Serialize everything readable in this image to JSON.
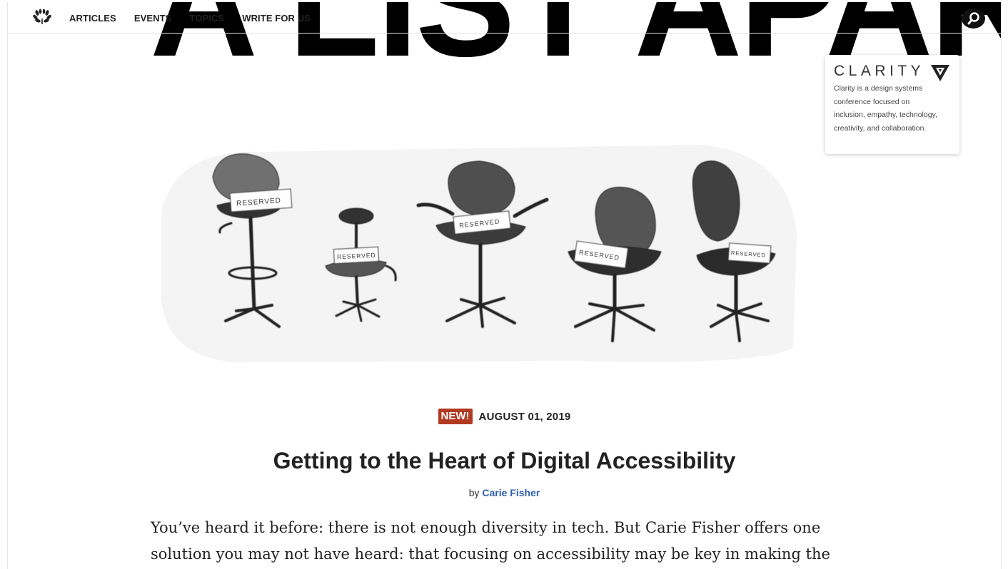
{
  "masthead": {
    "title": "A LIST APART"
  },
  "nav": {
    "logo_icon": "laurel-wreath-icon",
    "links": [
      "ARTICLES",
      "EVENTS",
      "TOPICS",
      "WRITE FOR US"
    ],
    "search_icon": "search-icon"
  },
  "sponsor": {
    "name": "CLARITY",
    "mark_icon": "clarity-logo-icon",
    "description": "Clarity is a design systems conference focused on inclusion, empathy, technology, creativity, and collaboration."
  },
  "hero": {
    "image": "reserved-chairs-illustration",
    "chair_labels": [
      "RESERVED",
      "RESERVED",
      "RESERVED",
      "RESERVED",
      "RESERVED"
    ]
  },
  "article": {
    "badge": "NEW!",
    "date": "AUGUST 01, 2019",
    "title": "Getting to the Heart of Digital Accessibility",
    "by_prefix": "by",
    "author": "Carie Fisher",
    "excerpt": "You’ve heard it before: there is not enough diversity in tech. But Carie Fisher offers one solution you may not have heard: that focusing on accessibility may be key in making the"
  },
  "colors": {
    "badge_bg": "#b03a22",
    "author_link": "#2e5fb0",
    "text": "#222222"
  }
}
